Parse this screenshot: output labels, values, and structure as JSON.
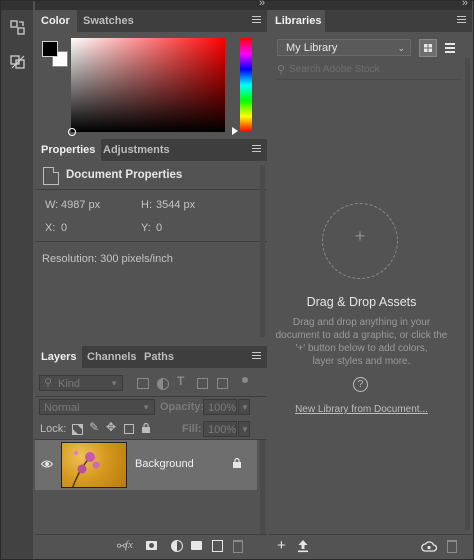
{
  "toolstrip": {
    "icons": [
      "history-icon",
      "layer-comps-icon"
    ]
  },
  "color_panel": {
    "tabs": [
      "Color",
      "Swatches"
    ]
  },
  "properties_panel": {
    "tabs": [
      "Properties",
      "Adjustments"
    ],
    "heading": "Document Properties",
    "w_label": "W:",
    "w_value": "4987 px",
    "h_label": "H:",
    "h_value": "3544 px",
    "x_label": "X:",
    "x_value": "0",
    "y_label": "Y:",
    "y_value": "0",
    "resolution": "Resolution: 300 pixels/inch"
  },
  "layers_panel": {
    "tabs": [
      "Layers",
      "Channels",
      "Paths"
    ],
    "filter_kind": "Kind",
    "blend_mode": "Normal",
    "opacity_label": "Opacity:",
    "opacity_value": "100%",
    "lock_label": "Lock:",
    "fill_label": "Fill:",
    "fill_value": "100%",
    "layers": [
      {
        "name": "Background",
        "visible": true,
        "locked": true
      }
    ]
  },
  "libraries_panel": {
    "tab": "Libraries",
    "library_select": "My Library",
    "search_placeholder": "Search Adobe Stock",
    "drop_title": "Drag & Drop Assets",
    "drop_text_1": "Drag and drop anything in your",
    "drop_text_2": "document to add a graphic, or click the",
    "drop_text_3": "'+' button below to add colors,",
    "drop_text_4": "layer styles and more.",
    "new_library_link": "New Library from Document..."
  },
  "collapse_glyph": "»",
  "colors": {
    "bg": "#535353",
    "tabbar": "#3e3e3e",
    "selected_layer": "#6e6e6e"
  }
}
